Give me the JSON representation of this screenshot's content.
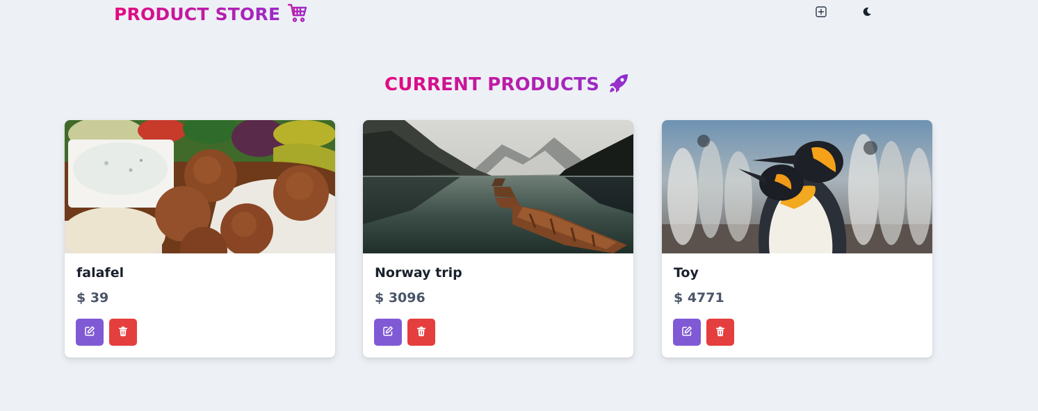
{
  "header": {
    "brand_title": "PRODUCT STORE",
    "brand_icon": "shopping-cart-icon",
    "create_icon": "plus-square-icon",
    "theme_icon": "moon-icon"
  },
  "main": {
    "heading": "CURRENT PRODUCTS",
    "heading_icon": "rocket-icon",
    "products": [
      {
        "name": "falafel",
        "price": "$ 39",
        "image": "falafel-photo"
      },
      {
        "name": "Norway trip",
        "price": "$ 3096",
        "image": "lake-boats-photo"
      },
      {
        "name": "Toy",
        "price": "$ 4771",
        "image": "penguins-photo"
      }
    ],
    "edit_icon": "edit-icon",
    "delete_icon": "trash-icon"
  },
  "colors": {
    "background": "#edf1f6",
    "gradient_start": "#e5097f",
    "gradient_end": "#9b2bc8",
    "edit_button": "#805ad5",
    "delete_button": "#e53e3e"
  }
}
